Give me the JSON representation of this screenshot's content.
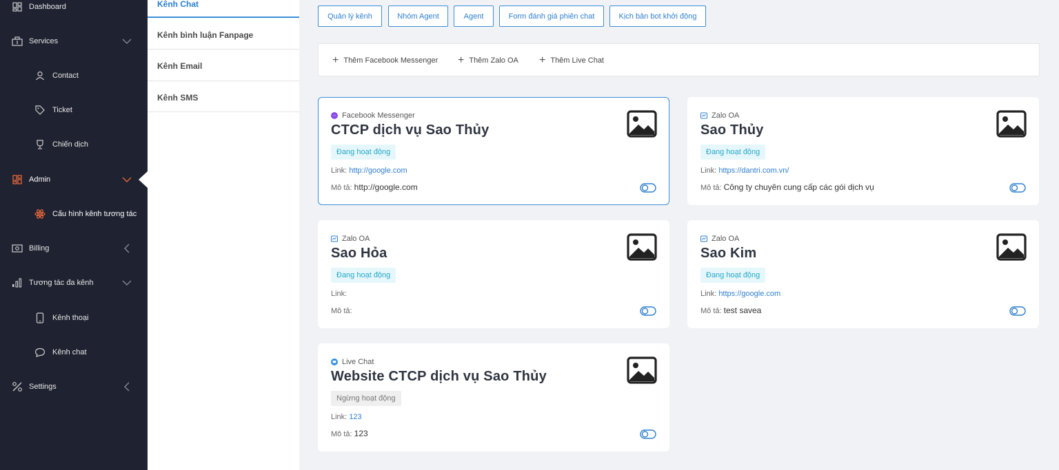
{
  "sidebar": {
    "items": [
      {
        "label": "Dashboard",
        "icon": "dashboard-icon"
      },
      {
        "label": "Services",
        "icon": "services-icon"
      },
      {
        "label": "Contact",
        "icon": "contact-icon"
      },
      {
        "label": "Ticket",
        "icon": "ticket-icon"
      },
      {
        "label": "Chiến dịch",
        "icon": "trophy-icon"
      },
      {
        "label": "Admin",
        "icon": "admin-icon"
      },
      {
        "label": "Cấu hình kênh tương tác",
        "icon": "config-icon"
      },
      {
        "label": "Billing",
        "icon": "billing-icon"
      },
      {
        "label": "Tương tác đa kênh",
        "icon": "chart-icon"
      },
      {
        "label": "Kênh thoại",
        "icon": "phone-icon"
      },
      {
        "label": "Kênh chat",
        "icon": "chat-icon"
      },
      {
        "label": "Settings",
        "icon": "settings-icon"
      }
    ]
  },
  "channels": [
    "Kênh Chat",
    "Kênh bình luận Fanpage",
    "Kênh Email",
    "Kênh SMS"
  ],
  "toolbar": {
    "buttons": [
      "Quản lý kênh",
      "Nhóm Agent",
      "Agent",
      "Form đánh giá phiên chat",
      "Kịch bản bot khởi động"
    ]
  },
  "add_bar": {
    "items": [
      "Thêm Facebook Messenger",
      "Thêm Zalo OA",
      "Thêm Live Chat"
    ]
  },
  "labels": {
    "link": "Link:",
    "desc": "Mô tả:"
  },
  "cards": [
    {
      "type": "Facebook Messenger",
      "name": "CTCP dịch vụ Sao Thủy",
      "status": "Đang hoạt động",
      "link": "http://google.com",
      "desc": "http://google.com"
    },
    {
      "type": "Zalo OA",
      "name": "Sao Thủy",
      "status": "Đang hoạt động",
      "link": "https://dantri.com.vn/",
      "desc": "Công ty chuyên cung cấp các gói dịch vụ"
    },
    {
      "type": "Zalo OA",
      "name": "Sao Hỏa",
      "status": "Đang hoạt động",
      "link": "",
      "desc": ""
    },
    {
      "type": "Zalo OA",
      "name": "Sao Kim",
      "status": "Đang hoạt động",
      "link": "https://google.com",
      "desc": "test savea"
    },
    {
      "type": "Live Chat",
      "name": "Website CTCP dịch vụ Sao Thủy",
      "status": "Ngừng hoạt động",
      "link": "123",
      "desc": "123"
    }
  ],
  "colors": {
    "sidebar_bg": "#1f2230",
    "accent": "#3a8fd9",
    "admin_accent": "#e8673c",
    "status_active": "#22a6c9"
  }
}
